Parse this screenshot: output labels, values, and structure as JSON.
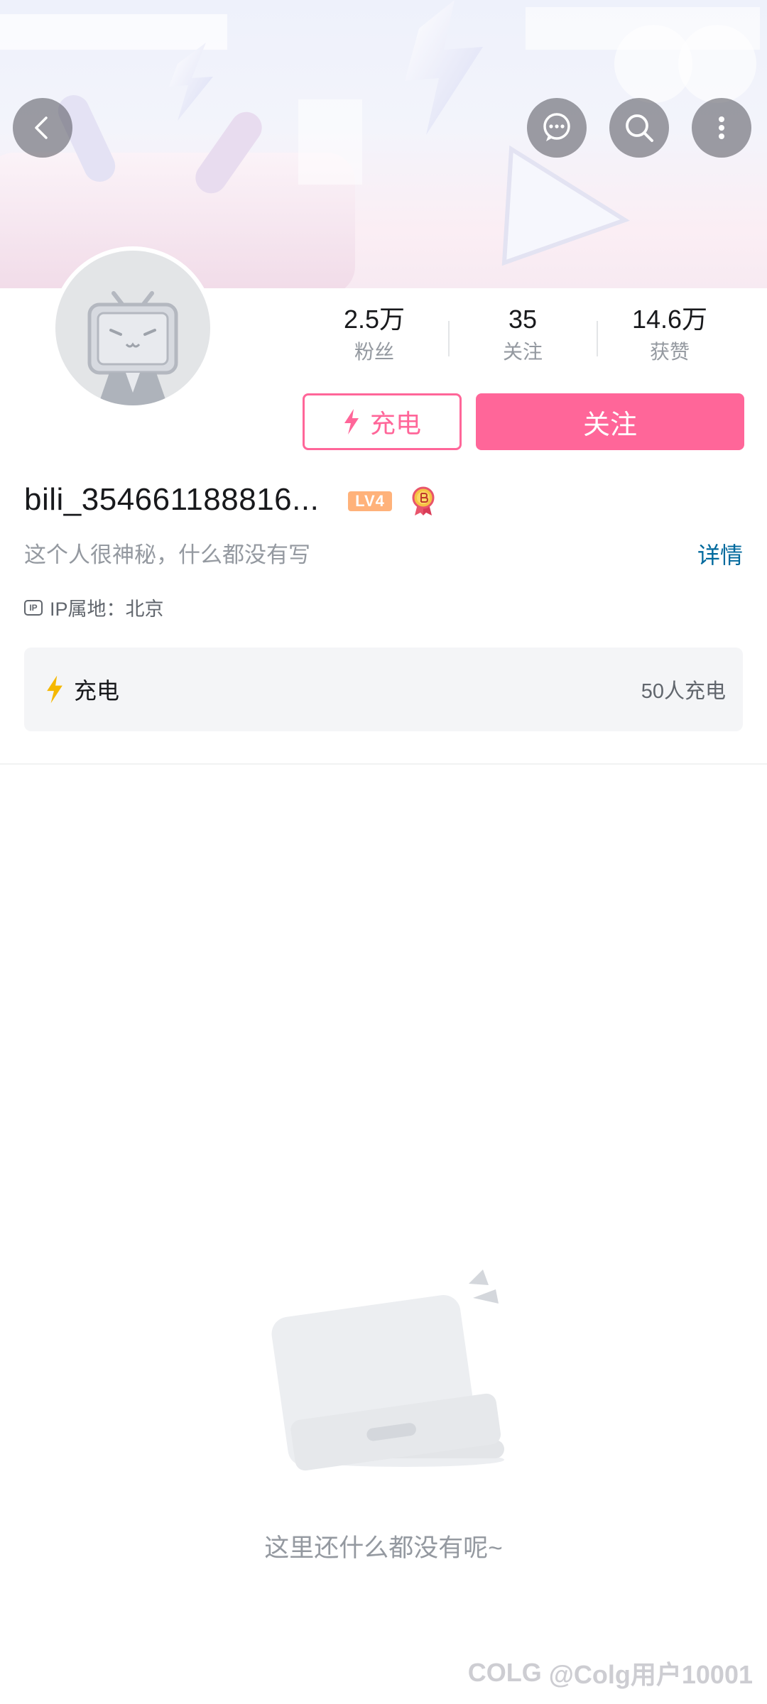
{
  "header": {
    "back_icon": "back-arrow-icon",
    "message_icon": "message-icon",
    "search_icon": "search-icon",
    "more_icon": "more-vertical-icon"
  },
  "stats": [
    {
      "value": "2.5万",
      "label": "粉丝"
    },
    {
      "value": "35",
      "label": "关注"
    },
    {
      "value": "14.6万",
      "label": "获赞"
    }
  ],
  "actions": {
    "charge_label": "充电",
    "follow_label": "关注"
  },
  "profile": {
    "username": "bili_354661188816...",
    "level": "LV4",
    "signature": "这个人很神秘，什么都没有写",
    "detail_link": "详情",
    "ip_badge": "IP",
    "ip_location": "IP属地：北京"
  },
  "charge_card": {
    "title": "充电",
    "count": "50人充电"
  },
  "empty_state": {
    "text": "这里还什么都没有呢~"
  },
  "watermark": {
    "logo": "COLG",
    "text": "@Colg用户10001"
  },
  "colors": {
    "accent_pink": "#ff6699",
    "link_blue": "#00699d",
    "charge_yellow": "#f5b800"
  }
}
